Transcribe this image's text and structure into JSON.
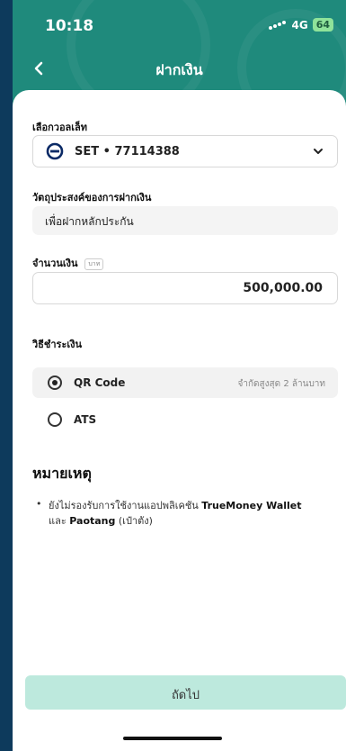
{
  "status_bar": {
    "time": "10:18",
    "network": "4G",
    "battery": "64"
  },
  "header": {
    "title": "ฝากเงิน"
  },
  "wallet": {
    "label": "เลือกวอลเล็ท",
    "selected": "SET • 77114388"
  },
  "purpose": {
    "label": "วัตถุประสงค์ของการฝากเงิน",
    "value": "เพื่อฝากหลักประกัน"
  },
  "amount": {
    "label": "จำนวนเงิน",
    "unit": "บาท",
    "value": "500,000.00"
  },
  "payment": {
    "label": "วิธีชำระเงิน",
    "options": [
      {
        "label": "QR Code",
        "hint": "จำกัดสูงสุด 2 ล้านบาท",
        "selected": true
      },
      {
        "label": "ATS",
        "hint": "",
        "selected": false
      }
    ]
  },
  "note": {
    "title": "หมายเหตุ",
    "bullet": "•",
    "text_prefix": "ยังไม่รองรับการใช้งานแอปพลิเคชัน ",
    "app1": "TrueMoney Wallet",
    "text_mid": "และ ",
    "app2": "Paotang",
    "text_suffix": " (เป๋าตัง)"
  },
  "next_button": {
    "label": "ถัดไป"
  },
  "colors": {
    "brand": "#1f8a7c",
    "next_button": "#bde9dd",
    "outer_background": "#0d3a5c"
  }
}
